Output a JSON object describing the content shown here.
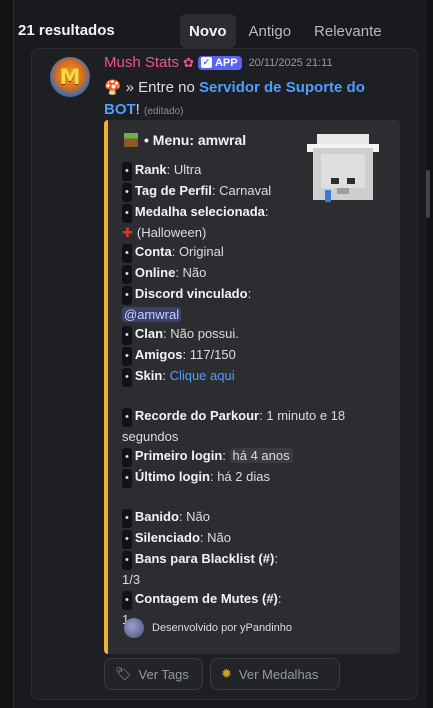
{
  "header": {
    "results": "21 resultados",
    "tabs": [
      {
        "label": "Novo",
        "active": true
      },
      {
        "label": "Antigo",
        "active": false
      },
      {
        "label": "Relevante",
        "active": false
      }
    ]
  },
  "message": {
    "author": "Mush Stats",
    "author_color": "#f0509c",
    "badge_icon": "flower-badge-icon",
    "app_tag": "APP",
    "timestamp": "20/11/2025 21:11",
    "text_prefix": "» Entre no ",
    "link_text": "Servidor de Suporte do BOT",
    "text_suffix": "!",
    "edited": "(editado)"
  },
  "embed": {
    "accent_color": "#f0b232",
    "title": "• Menu: amwral",
    "bullet": "•",
    "fields": [
      {
        "key": "Rank",
        "value": "Ultra"
      },
      {
        "key": "Tag de Perfil",
        "value": "Carnaval"
      },
      {
        "key": "Medalha selecionada",
        "value": "(Halloween)"
      },
      {
        "key": "Conta",
        "value": "Original"
      },
      {
        "key": "Online",
        "value": "Não"
      },
      {
        "key": "Discord vinculado",
        "value": "@amwral"
      },
      {
        "key": "Clan",
        "value": "Não possui."
      },
      {
        "key": "Amigos",
        "value": "117/150"
      },
      {
        "key": "Skin",
        "value": "Clique aqui"
      },
      {
        "key": "Recorde do Parkour",
        "value": "1 minuto e 18 segundos"
      },
      {
        "key": "Primeiro login",
        "value": "há 4 anos"
      },
      {
        "key": "Último login",
        "value": "há 2 dias"
      },
      {
        "key": "Banido",
        "value": "Não"
      },
      {
        "key": "Silenciado",
        "value": "Não"
      },
      {
        "key": "Bans para Blacklist (#)",
        "value": "1/3"
      },
      {
        "key": "Contagem de Mutes (#)",
        "value": "1"
      }
    ],
    "footer": "Desenvolvido por yPandinho"
  },
  "buttons": {
    "tags": "Ver Tags",
    "medals": "Ver Medalhas"
  }
}
